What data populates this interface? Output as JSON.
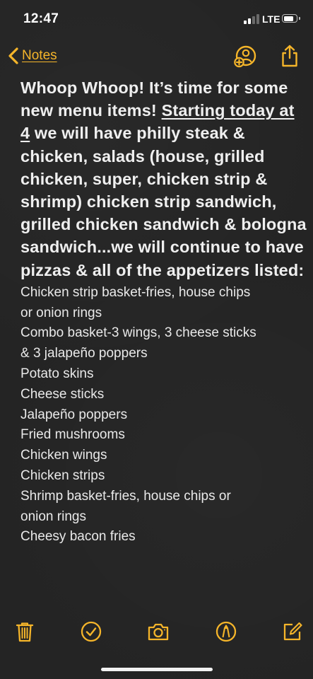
{
  "status_bar": {
    "time": "12:47",
    "carrier": "LTE",
    "signal_bars_active": 2,
    "signal_bars_total": 4
  },
  "nav": {
    "back_label": "Notes",
    "accent_color": "#f5b52a",
    "icons": [
      "add-people-icon",
      "share-icon"
    ]
  },
  "note": {
    "headline": {
      "part1": "Whoop Whoop! It’s time for some new menu items! ",
      "underlined": "Starting today at 4",
      "part2": " we will have philly steak & chicken, salads (house, grilled chicken, super, chicken strip & shrimp) chicken strip sandwich, grilled chicken sandwich & bologna sandwich...we will continue to have pizzas & all of the appetizers listed:"
    },
    "lines": [
      "Chicken strip basket-fries, house chips",
      "or onion rings",
      "Combo basket-3 wings, 3 cheese sticks",
      "& 3 jalapeño poppers",
      "Potato skins",
      "Cheese sticks",
      "Jalapeño poppers",
      "Fried mushrooms",
      "Chicken wings",
      "Chicken strips",
      "Shrimp basket-fries, house chips or",
      "onion rings",
      "Cheesy bacon fries"
    ]
  },
  "toolbar": {
    "icons": [
      "trash-icon",
      "checklist-icon",
      "camera-icon",
      "markup-icon",
      "compose-icon"
    ]
  }
}
